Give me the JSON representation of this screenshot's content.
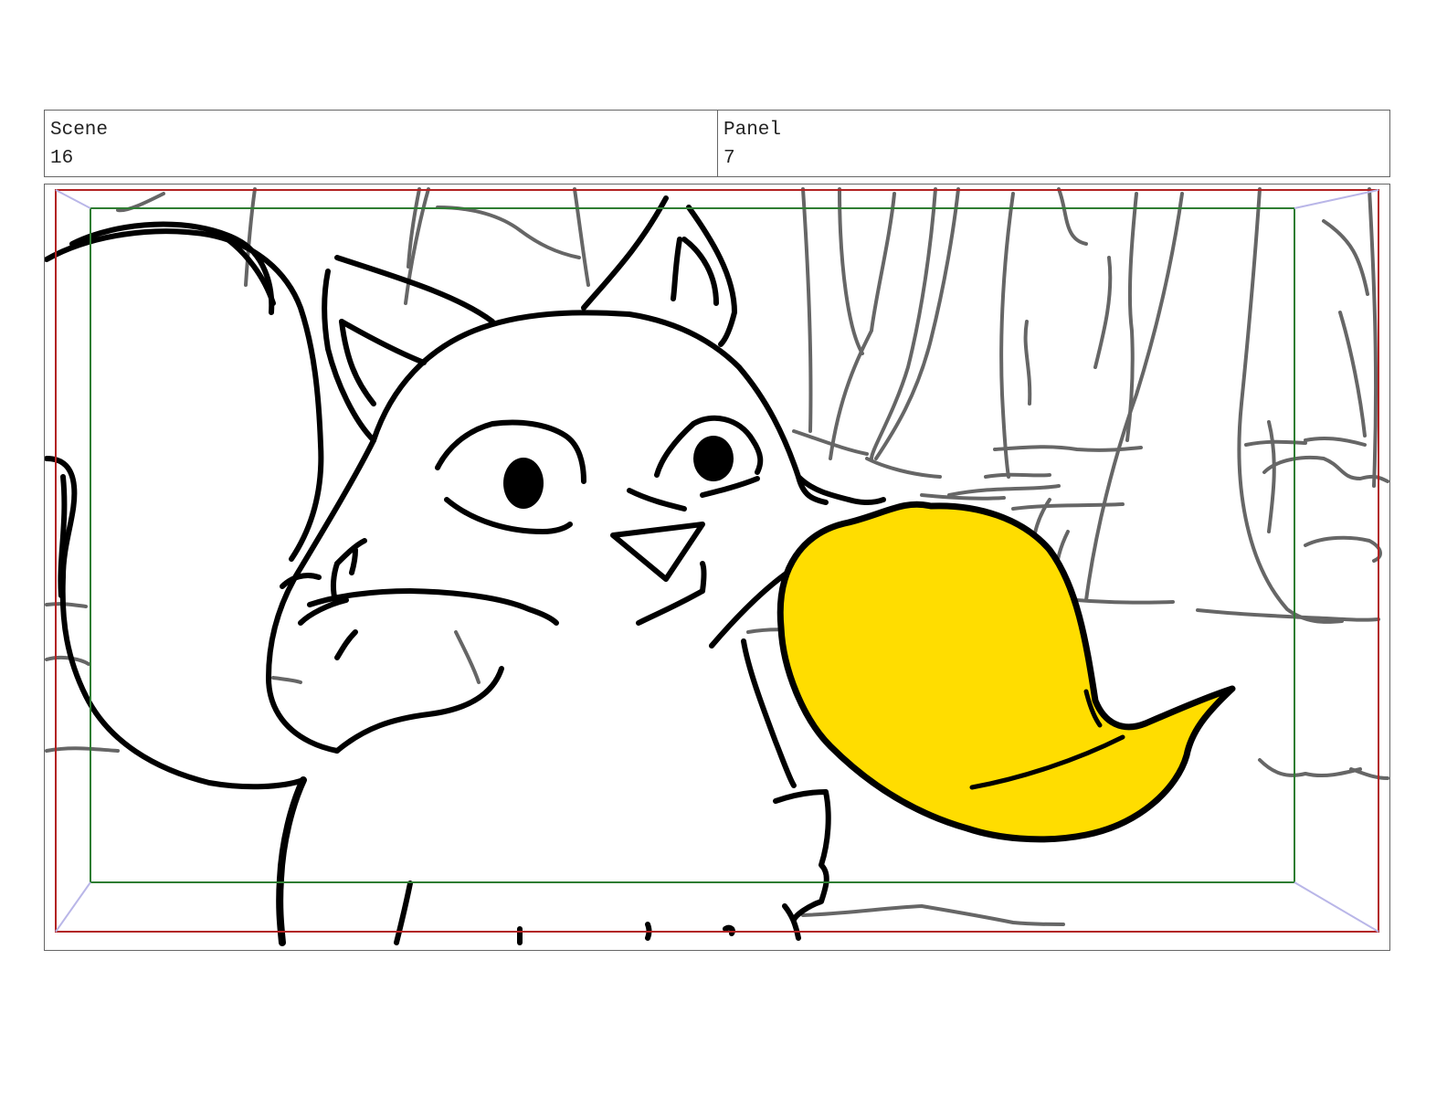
{
  "header": {
    "scene_label": "Scene",
    "scene_value": "16",
    "panel_label": "Panel",
    "panel_value": "7"
  },
  "colors": {
    "border": "#666666",
    "action_safe": "#b22222",
    "title_safe": "#2e7d32",
    "bubble_fill": "#ffdd00",
    "ink": "#000000",
    "background_lines": "#666666"
  },
  "artwork": {
    "icon": "storyboard-sketch",
    "subjects": [
      "fox",
      "yellow-bubble",
      "forest-background"
    ]
  }
}
